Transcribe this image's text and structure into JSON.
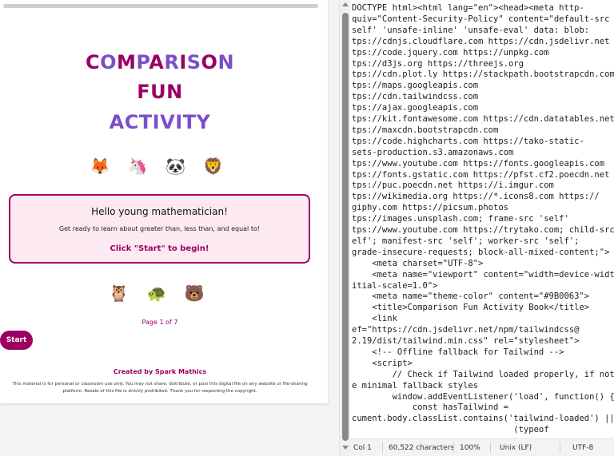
{
  "preview": {
    "title_line1_parts": [
      {
        "text": "C",
        "alt": false
      },
      {
        "text": "O",
        "alt": true
      },
      {
        "text": "M",
        "alt": false
      },
      {
        "text": "P",
        "alt": true
      },
      {
        "text": "A",
        "alt": false
      },
      {
        "text": "R",
        "alt": true
      },
      {
        "text": "I",
        "alt": false
      },
      {
        "text": "S",
        "alt": true
      },
      {
        "text": "O",
        "alt": false
      },
      {
        "text": "N",
        "alt": true
      }
    ],
    "title_line2": "FUN",
    "title_line3": "ACTIVITY",
    "emoji_row1": "🦊 🦄 🐼 🦁",
    "card": {
      "greeting": "Hello young mathematician!",
      "body": "Get ready to learn about greater than, less than, and equal to!",
      "cta": "Click \"Start\" to begin!"
    },
    "emoji_row2": "🦉 🐢 🐻",
    "page_indicator": "Page 1 of 7",
    "start_label": "Start",
    "credit": "Created by Spark Mathics",
    "disclaimer": "This material is for personal or classroom use only. You may not share, distribute, or post this digital file on any website or file-sharing platform. Resale of this file is strictly prohibited. Thank you for respecting the copyright."
  },
  "code_lines": [
    "DOCTYPE html><html lang=\"en\"><head><meta http-",
    "quiv=\"Content-Security-Policy\" content=\"default-src",
    "self' 'unsafe-inline' 'unsafe-eval' data: blob:",
    "tps://cdnjs.cloudflare.com https://cdn.jsdelivr.net",
    "tps://code.jquery.com https://unpkg.com",
    "tps://d3js.org https://threejs.org",
    "tps://cdn.plot.ly https://stackpath.bootstrapcdn.com",
    "tps://maps.googleapis.com",
    "tps://cdn.tailwindcss.com",
    "tps://ajax.googleapis.com",
    "tps://kit.fontawesome.com https://cdn.datatables.net",
    "tps://maxcdn.bootstrapcdn.com",
    "tps://code.highcharts.com https://tako-static-",
    "sets-production.s3.amazonaws.com",
    "tps://www.youtube.com https://fonts.googleapis.com",
    "tps://fonts.gstatic.com https://pfst.cf2.poecdn.net",
    "tps://puc.poecdn.net https://i.imgur.com",
    "tps://wikimedia.org https://*.icons8.com https://",
    "giphy.com https://picsum.photos",
    "tps://images.unsplash.com; frame-src 'self'",
    "tps://www.youtube.com https://trytako.com; child-src",
    "elf'; manifest-src 'self'; worker-src 'self';",
    "grade-insecure-requests; block-all-mixed-content;\">",
    "    <meta charset=\"UTF-8\">",
    "    <meta name=\"viewport\" content=\"width=device-width,",
    "itial-scale=1.0\">",
    "    <meta name=\"theme-color\" content=\"#9B0063\">",
    "    <title>Comparison Fun Activity Book</title>",
    "    <link",
    "ef=\"https://cdn.jsdelivr.net/npm/tailwindcss@",
    "2.19/dist/tailwind.min.css\" rel=\"stylesheet\">",
    "    <!-- Offline fallback for Tailwind -->",
    "    <script>",
    "        // Check if Tailwind loaded properly, if not,",
    "e minimal fallback styles",
    "        window.addEventListener('load', function() {",
    "            const hasTailwind =",
    "cument.body.classList.contains('tailwind-loaded') ||",
    "                                (typeof"
  ],
  "statusbar": {
    "position": "Col 1",
    "characters": "60,522 characters",
    "zoom": "100%",
    "line_ending": "Unix (LF)",
    "encoding": "UTF-8"
  },
  "colors": {
    "primary": "#9b0063",
    "accent": "#7b4fc9",
    "card_bg": "#fde9f2"
  }
}
